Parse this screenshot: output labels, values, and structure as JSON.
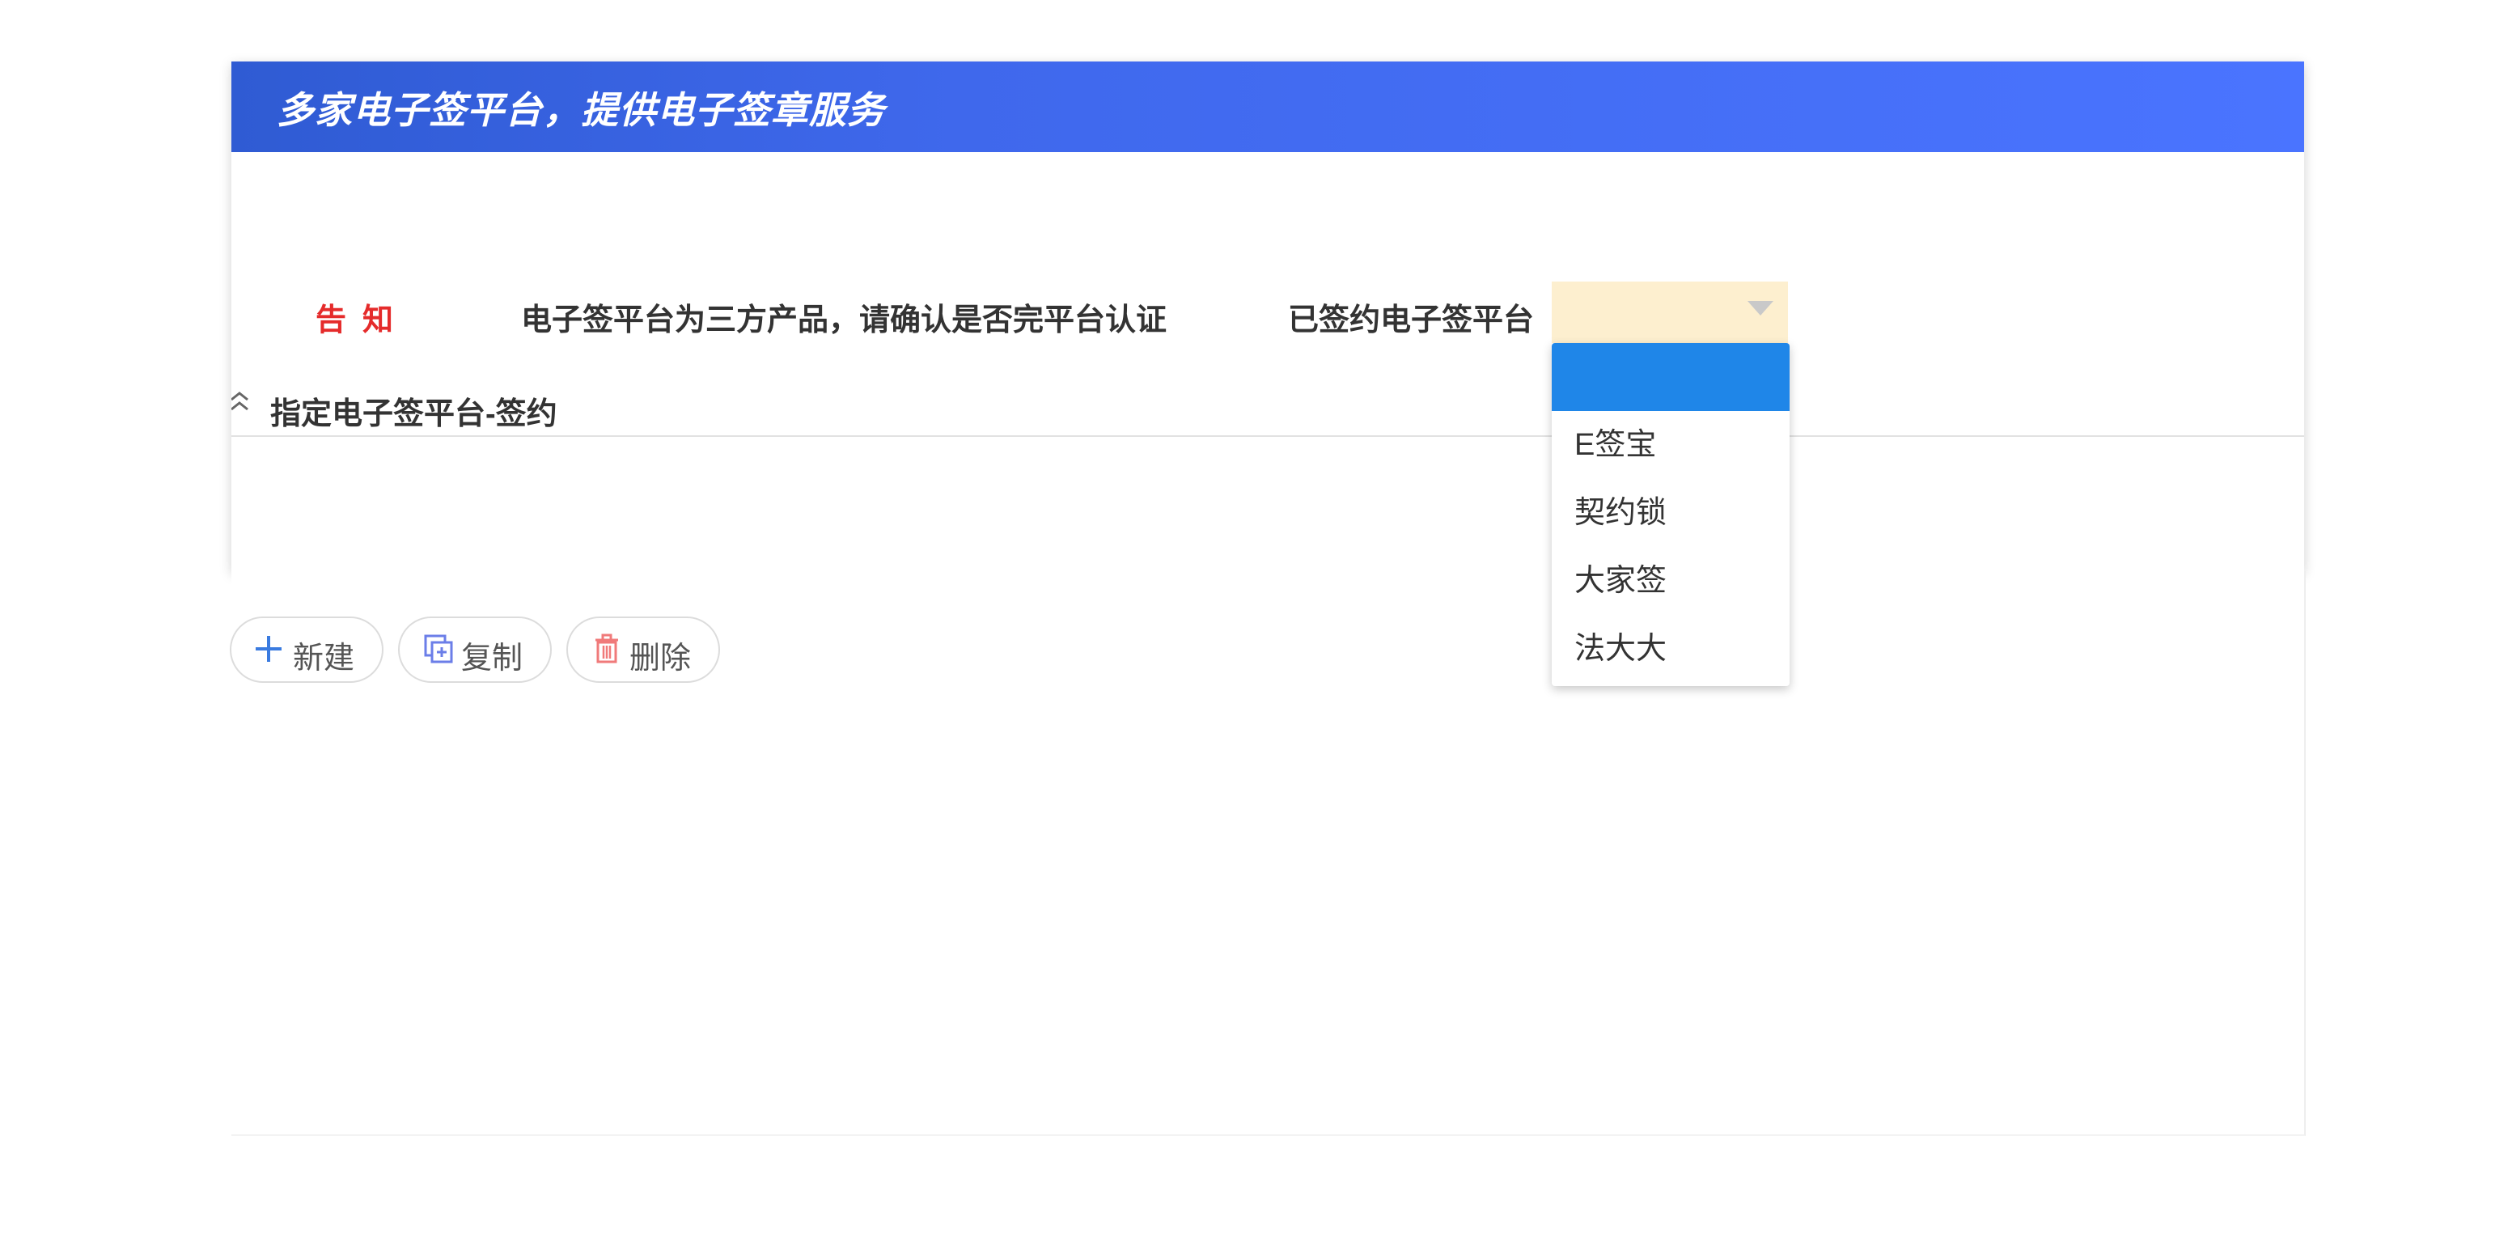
{
  "banner": {
    "title": "多家电子签平台，提供电子签章服务"
  },
  "form": {
    "notice_label": "告知",
    "notice_text": "电子签平台为三方产品，请确认是否完平台认证",
    "platform_label": "已签约电子签平台",
    "platform_value": ""
  },
  "section": {
    "title": "指定电子签平台-签约"
  },
  "toolbar": {
    "new_label": "新建",
    "copy_label": "复制",
    "delete_label": "删除"
  },
  "dropdown": {
    "options": [
      "",
      "E签宝",
      "契约锁",
      "大家签",
      "法大大"
    ],
    "selected_index": 0,
    "highlight_color": "#1f86e8"
  },
  "colors": {
    "banner_start": "#2f5bd3",
    "banner_end": "#4a74ff",
    "notice_red": "#e52b2b",
    "select_bg": "#fdefcf"
  }
}
